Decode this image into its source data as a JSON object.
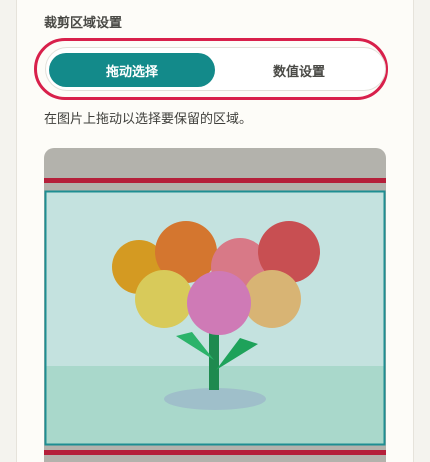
{
  "crop": {
    "section_title": "裁剪区域设置",
    "modes": [
      {
        "label": "拖动选择",
        "active": true
      },
      {
        "label": "数值设置",
        "active": false
      }
    ],
    "hint": "在图片上拖动以选择要保留的区域。"
  },
  "colors": {
    "accent": "#138a8a",
    "highlight": "#d8204b",
    "crop_border": "#1e8e92"
  }
}
